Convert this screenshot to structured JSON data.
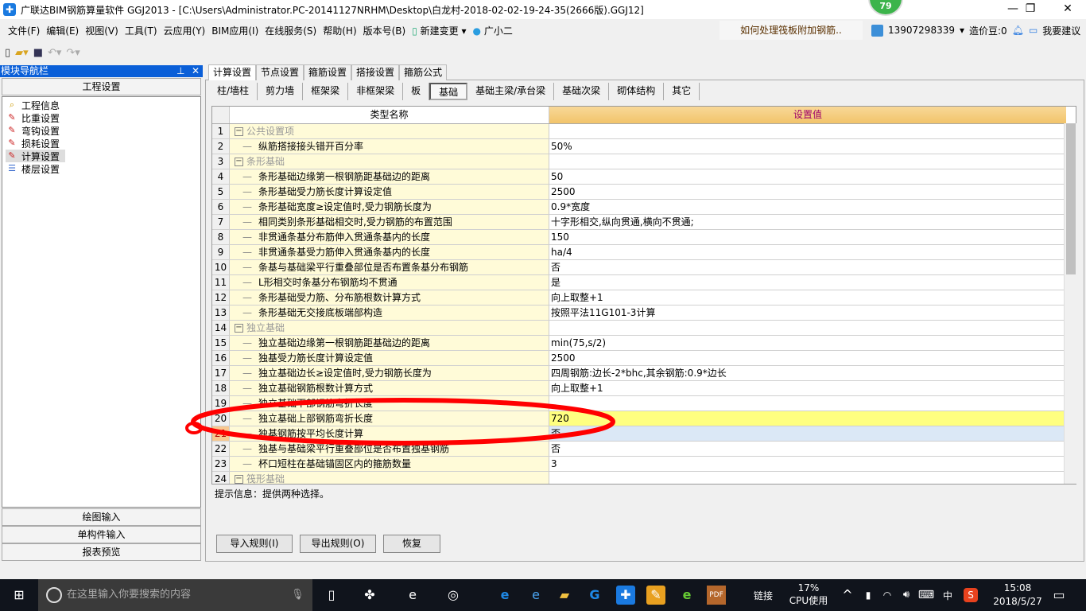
{
  "window": {
    "title": "广联达BIM钢筋算量软件 GGJ2013 - [C:\\Users\\Administrator.PC-20141127NRHM\\Desktop\\白龙村-2018-02-02-19-24-35(2666版).GGJ12]",
    "badge": "79"
  },
  "menu": [
    "文件(F)",
    "编辑(E)",
    "视图(V)",
    "工具(T)",
    "云应用(Y)",
    "BIM应用(I)",
    "在线服务(S)",
    "帮助(H)",
    "版本号(B)",
    "新建变更",
    "广小二"
  ],
  "tip": "如何处理筏板附加钢筋..",
  "user": {
    "phone": "13907298339",
    "beans": "造价豆:0",
    "suggest": "我要建议"
  },
  "nav": {
    "title": "模块导航栏",
    "section": "工程设置",
    "items": [
      "工程信息",
      "比重设置",
      "弯钩设置",
      "损耗设置",
      "计算设置",
      "楼层设置"
    ],
    "selected": "计算设置",
    "bottom": [
      "绘图输入",
      "单构件输入",
      "报表预览"
    ]
  },
  "tabs": [
    "计算设置",
    "节点设置",
    "箍筋设置",
    "搭接设置",
    "箍筋公式"
  ],
  "subtabs": [
    "柱/墙柱",
    "剪力墙",
    "框架梁",
    "非框架梁",
    "板",
    "基础",
    "基础主梁/承台梁",
    "基础次梁",
    "砌体结构",
    "其它"
  ],
  "grid": {
    "headers": [
      "类型名称",
      "设置值"
    ],
    "rows": [
      {
        "n": "1",
        "name": "公共设置项",
        "value": "",
        "group": true
      },
      {
        "n": "2",
        "name": "纵筋搭接接头错开百分率",
        "value": "50%"
      },
      {
        "n": "3",
        "name": "条形基础",
        "value": "",
        "group": true
      },
      {
        "n": "4",
        "name": "条形基础边缘第一根钢筋距基础边的距离",
        "value": "50"
      },
      {
        "n": "5",
        "name": "条形基础受力筋长度计算设定值",
        "value": "2500"
      },
      {
        "n": "6",
        "name": "条形基础宽度≥设定值时,受力钢筋长度为",
        "value": "0.9*宽度"
      },
      {
        "n": "7",
        "name": "相同类别条形基础相交时,受力钢筋的布置范围",
        "value": "十字形相交,纵向贯通,横向不贯通;"
      },
      {
        "n": "8",
        "name": "非贯通条基分布筋伸入贯通条基内的长度",
        "value": "150"
      },
      {
        "n": "9",
        "name": "非贯通条基受力筋伸入贯通条基内的长度",
        "value": "ha/4"
      },
      {
        "n": "10",
        "name": "条基与基础梁平行重叠部位是否布置条基分布钢筋",
        "value": "否"
      },
      {
        "n": "11",
        "name": "L形相交时条基分布钢筋均不贯通",
        "value": "是"
      },
      {
        "n": "12",
        "name": "条形基础受力筋、分布筋根数计算方式",
        "value": "向上取整+1"
      },
      {
        "n": "13",
        "name": "条形基础无交接底板端部构造",
        "value": "按照平法11G101-3计算"
      },
      {
        "n": "14",
        "name": "独立基础",
        "value": "",
        "group": true
      },
      {
        "n": "15",
        "name": "独立基础边缘第一根钢筋距基础边的距离",
        "value": "min(75,s/2)"
      },
      {
        "n": "16",
        "name": "独基受力筋长度计算设定值",
        "value": "2500"
      },
      {
        "n": "17",
        "name": "独立基础边长≥设定值时,受力钢筋长度为",
        "value": "四周钢筋:边长-2*bhc,其余钢筋:0.9*边长"
      },
      {
        "n": "18",
        "name": "独立基础钢筋根数计算方式",
        "value": "向上取整+1"
      },
      {
        "n": "19",
        "name": "独立基础下部钢筋弯折长度",
        "value": ""
      },
      {
        "n": "20",
        "name": "独立基础上部钢筋弯折长度",
        "value": "720",
        "highlight": true
      },
      {
        "n": "21",
        "name": "独基钢筋按平均长度计算",
        "value": "否",
        "current": true
      },
      {
        "n": "22",
        "name": "独基与基础梁平行重叠部位是否布置独基钢筋",
        "value": "否"
      },
      {
        "n": "23",
        "name": "杯口短柱在基础锚固区内的箍筋数量",
        "value": "3"
      },
      {
        "n": "24",
        "name": "筏形基础",
        "value": "",
        "group": true
      }
    ]
  },
  "hint": "提示信息：提供两种选择。",
  "buttons": {
    "import": "导入规则(I)",
    "export": "导出规则(O)",
    "restore": "恢复"
  },
  "taskbar": {
    "search": "在这里输入你要搜索的内容",
    "link": "链接",
    "cpu": "17%",
    "cpu_label": "CPU使用",
    "ime": "中",
    "time": "15:08",
    "date": "2018/5/27"
  },
  "colors": {
    "annotation": "#ff0000",
    "nav_header": "#0a5fd8",
    "highlight": "#ffff80",
    "header_accent": "#f2c46a"
  }
}
